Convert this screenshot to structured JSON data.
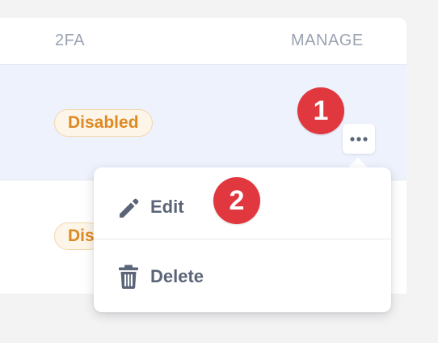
{
  "table": {
    "columns": {
      "twofa": "2FA",
      "manage": "MANAGE"
    },
    "rows": [
      {
        "twofa_status": "Disabled"
      },
      {
        "twofa_status": "Disabled"
      }
    ]
  },
  "menu": {
    "edit_label": "Edit",
    "delete_label": "Delete"
  },
  "markers": {
    "first": "1",
    "second": "2"
  },
  "icons": {
    "more": "ellipsis-icon",
    "edit": "pencil-icon",
    "delete": "trash-icon"
  },
  "colors": {
    "badge_text": "#dd8a23",
    "badge_bg": "#fdf5e8",
    "marker": "#e0383e",
    "selected_row": "#eef2fd"
  }
}
